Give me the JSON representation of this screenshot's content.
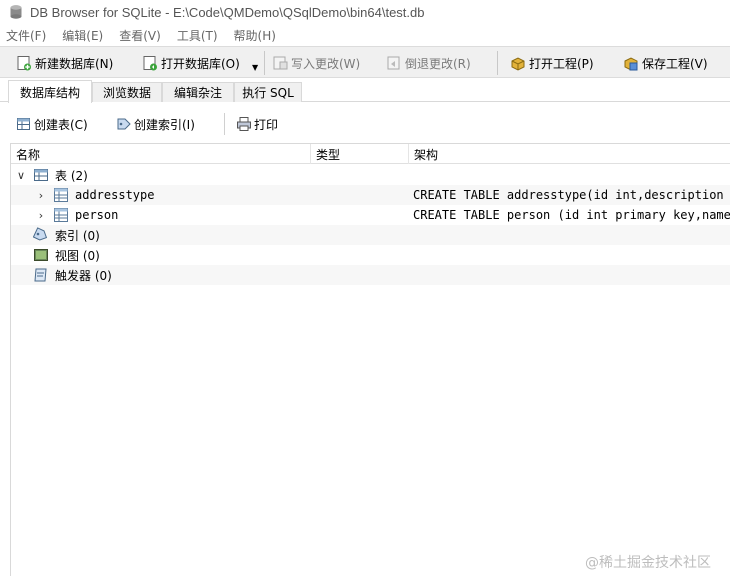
{
  "window": {
    "title": "DB Browser for SQLite - E:\\Code\\QMDemo\\QSqlDemo\\bin64\\test.db"
  },
  "menu": [
    "文件(F)",
    "编辑(E)",
    "查看(V)",
    "工具(T)",
    "帮助(H)"
  ],
  "toolbar": {
    "new_db": "新建数据库(N)",
    "open_db": "打开数据库(O)",
    "write_changes": "写入更改(W)",
    "revert_changes": "倒退更改(R)",
    "open_project": "打开工程(P)",
    "save_project": "保存工程(V)"
  },
  "tabs": [
    "数据库结构",
    "浏览数据",
    "编辑杂注",
    "执行 SQL"
  ],
  "subtoolbar": {
    "create_table": "创建表(C)",
    "create_index": "创建索引(I)",
    "print": "打印"
  },
  "tree": {
    "columns": [
      "名称",
      "类型",
      "架构"
    ],
    "tables_node": "表 (2)",
    "tables": [
      {
        "name": "addresstype",
        "schema": "CREATE TABLE addresstype(id int,description v"
      },
      {
        "name": "person",
        "schema": "CREATE TABLE person (id int primary key,name t"
      }
    ],
    "indexes_node": "索引 (0)",
    "views_node": "视图 (0)",
    "triggers_node": "触发器 (0)"
  },
  "watermark": "@稀土掘金技术社区"
}
